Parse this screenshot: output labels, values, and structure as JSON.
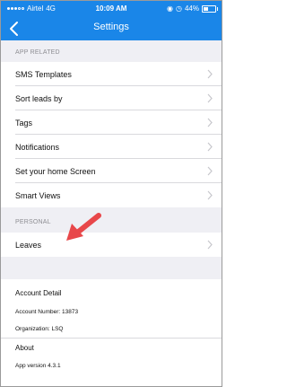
{
  "status": {
    "carrier": "Airtel",
    "network": "4G",
    "time": "10:09 AM",
    "battery": "44%",
    "battery_level": 0.44
  },
  "nav": {
    "title": "Settings",
    "back_icon": "chevron-left-icon"
  },
  "sections": {
    "app_related": "APP RELATED",
    "personal": "PERSONAL"
  },
  "rows": {
    "sms_templates": "SMS Templates",
    "sort_leads": "Sort leads by",
    "tags": "Tags",
    "notifications": "Notifications",
    "home_screen": "Set your home Screen",
    "smart_views": "Smart Views",
    "leaves": "Leaves"
  },
  "account": {
    "title": "Account Detail",
    "number": "Account Number: 13873",
    "organization": "Organization: LSQ"
  },
  "about": {
    "title": "About",
    "version": "App version 4.3.1"
  },
  "colors": {
    "primary": "#1a86e8",
    "annotation_arrow": "#e8474a"
  }
}
